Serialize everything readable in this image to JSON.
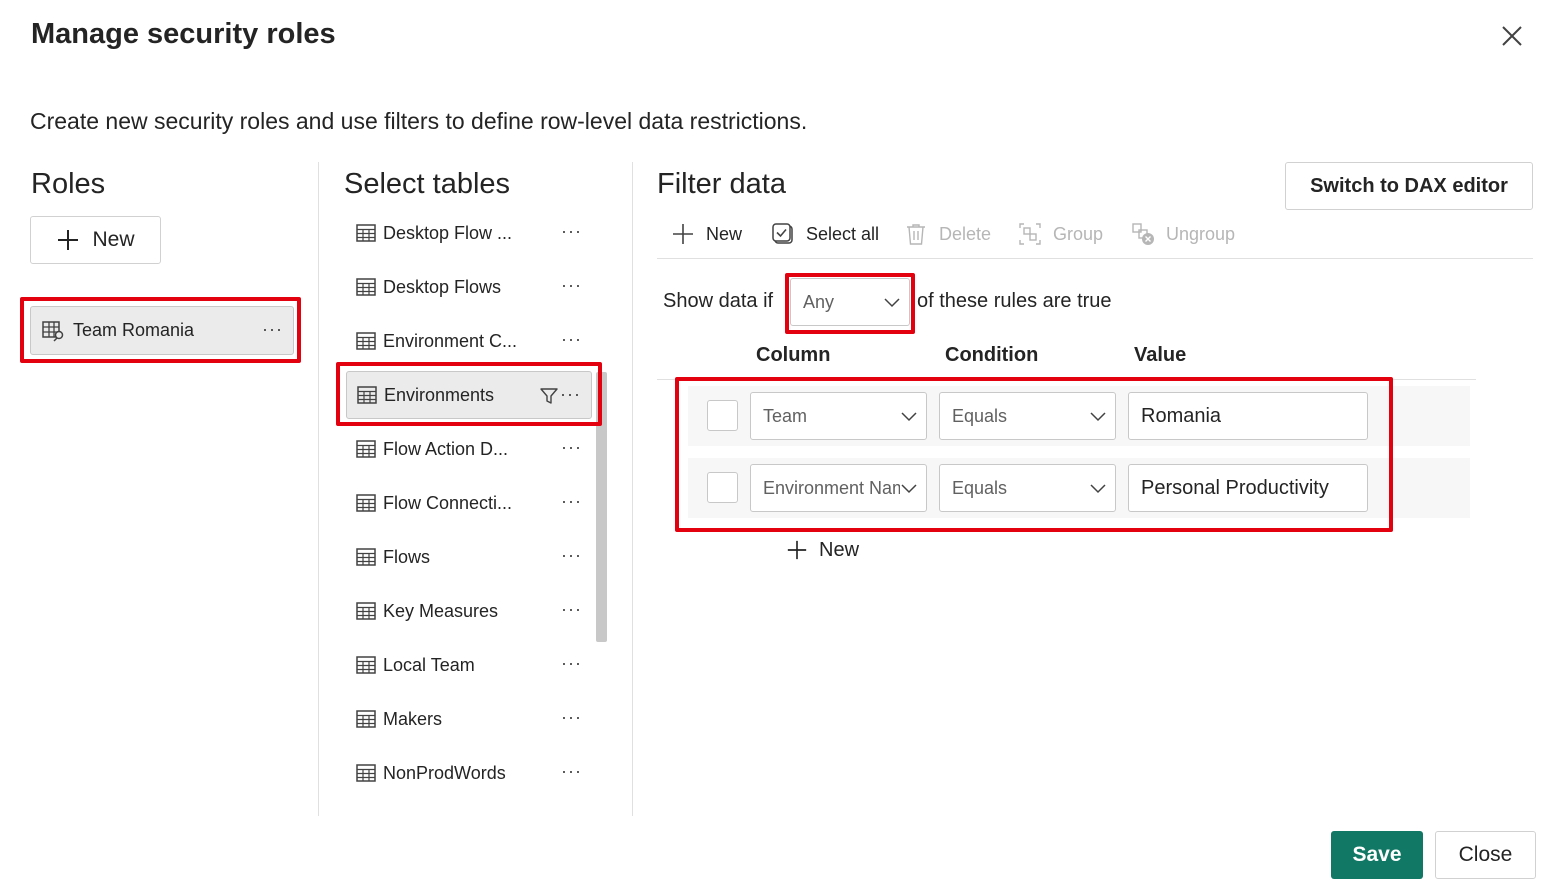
{
  "dialog": {
    "title": "Manage security roles",
    "subtitle": "Create new security roles and use filters to define row-level data restrictions."
  },
  "roles": {
    "heading": "Roles",
    "new_label": "New",
    "items": [
      {
        "label": "Team Romania",
        "selected": true
      }
    ]
  },
  "tables": {
    "heading": "Select tables",
    "items": [
      {
        "label": "Desktop Flow ..."
      },
      {
        "label": "Desktop Flows"
      },
      {
        "label": "Environment C..."
      },
      {
        "label": "Environments",
        "selected": true,
        "has_filter": true
      },
      {
        "label": "Flow Action D..."
      },
      {
        "label": "Flow Connecti..."
      },
      {
        "label": "Flows"
      },
      {
        "label": "Key Measures"
      },
      {
        "label": "Local Team"
      },
      {
        "label": "Makers"
      },
      {
        "label": "NonProdWords"
      }
    ]
  },
  "filter": {
    "heading": "Filter data",
    "switch_label": "Switch to DAX editor",
    "toolbar": {
      "new": "New",
      "select_all": "Select all",
      "delete": "Delete",
      "group": "Group",
      "ungroup": "Ungroup"
    },
    "show_data_if": "Show data if",
    "match_mode": "Any",
    "rules_are_true": "of these rules are true",
    "headers": {
      "column": "Column",
      "condition": "Condition",
      "value": "Value"
    },
    "rules": [
      {
        "column": "Team",
        "condition": "Equals",
        "value": "Romania"
      },
      {
        "column": "Environment Name",
        "condition": "Equals",
        "value": "Personal Productivity"
      }
    ],
    "add_rule_label": "New"
  },
  "footer": {
    "save_label": "Save",
    "close_label": "Close"
  },
  "colors": {
    "accent": "#117865",
    "highlight": "#e3000f"
  }
}
